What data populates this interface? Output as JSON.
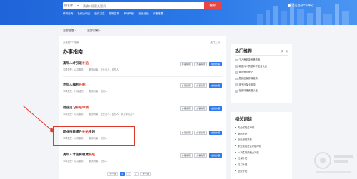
{
  "header": {
    "search_select": "按名称",
    "search_placeholder": "请输入搜索关键词",
    "search_button": "搜索",
    "login_tip": "点击登录个人中心",
    "hot_links": [
      "教育查询",
      "社保公积金",
      "医疗卫生",
      "婚姻生育",
      "不动产权",
      "就业创业",
      "户籍管理"
    ]
  },
  "filters": [
    {
      "label": "全部主题"
    },
    {
      "label": "全部对象"
    }
  ],
  "main": {
    "count_text": "共找到5个结果",
    "expand_text": "展开工具",
    "section_title": "办事指南",
    "items": [
      {
        "name_pre": "高年人才引进",
        "name_hl": "补贴",
        "name_post": "",
        "type": "事项类型：公共服务",
        "dept": "服务对象：企业法人，自然人",
        "buttons": [
          "办事指南",
          "办事指南",
          "在线办理"
        ]
      },
      {
        "name_pre": "老年人福利",
        "name_hl": "补贴",
        "name_post": "",
        "type": "事项类型：行政给付",
        "dept": "服务对象：自然人",
        "buttons": [
          "办事指南",
          "办事指南",
          "在线办理"
        ]
      },
      {
        "name_pre": "就业见习",
        "name_hl": "补贴申领",
        "name_post": "",
        "type": "事项类型：公共服务",
        "dept": "服务对象：企业法人，自然人，事业单位法人",
        "buttons": [
          "办事指南",
          "办事指南",
          "在线办理"
        ]
      },
      {
        "name_pre": "职业技能提升",
        "name_hl": "补贴",
        "name_post": "申领",
        "type": "事项类型：公共服务",
        "dept": "服务对象：自然人",
        "buttons": [
          "办事指南",
          "办事指南",
          "在线办理"
        ]
      },
      {
        "name_pre": "高年人才住房租赁",
        "name_hl": "补贴",
        "name_post": "",
        "type": "事项类型：公共服务",
        "dept": "服务对象：自然人",
        "buttons": [
          "办事指南",
          "办事指南",
          "在线办理"
        ]
      }
    ]
  },
  "pager": {
    "prev": "上一页",
    "pages": [
      "1",
      "2",
      "3"
    ],
    "active": "1",
    "next": "下一页"
  },
  "sidebar": {
    "hot": {
      "title": "热门推荐",
      "more": "换一换",
      "items": [
        "个人养老金资格查询",
        "离退休人员基本养老金认证",
        "规范就业登记",
        "居民医保参保缴费",
        "电子社保卡申领",
        "社保待遇资格认证"
      ]
    },
    "related": {
      "title": "相关词组",
      "items": [
        "失业保险金申领",
        "求职补贴",
        "创业担保贷款",
        "职业技能鉴定补贴申领",
        "一次性吸纳就业补贴",
        "社保补贴",
        "见习补贴",
        "创业补贴"
      ]
    }
  },
  "colors": {
    "primary": "#2f7cf0",
    "accent_red": "#e0392b",
    "banner": "#1f64d8"
  }
}
